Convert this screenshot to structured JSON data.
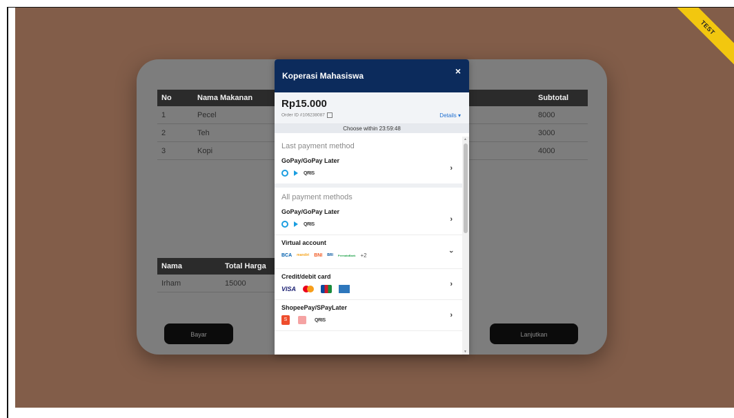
{
  "test_ribbon": "TEST",
  "background_table": {
    "headers": [
      "No",
      "Nama Makanan",
      "Subtotal"
    ],
    "rows": [
      {
        "no": "1",
        "name": "Pecel",
        "subtotal": "8000"
      },
      {
        "no": "2",
        "name": "Teh",
        "subtotal": "3000"
      },
      {
        "no": "3",
        "name": "Kopi",
        "subtotal": "4000"
      }
    ]
  },
  "summary_table": {
    "headers": [
      "Nama",
      "Total Harga"
    ],
    "row": {
      "name": "Irham",
      "total": "15000"
    }
  },
  "buttons": {
    "bayar": "Bayar",
    "lanjutkan": "Lanjutkan"
  },
  "modal": {
    "title": "Koperasi Mahasiswa",
    "close": "×",
    "amount": "Rp15.000",
    "order_id": "Order ID #106238087",
    "details": "Details ▾",
    "timer": "Choose within 23:59:48",
    "last_label": "Last payment method",
    "all_label": "All payment methods",
    "methods": {
      "last_gopay": "GoPay/GoPay Later",
      "gopay": "GoPay/GoPay Later",
      "va": "Virtual account",
      "card": "Credit/debit card",
      "shopee": "ShopeePay/SPayLater"
    },
    "va_logos": {
      "bca": "BCA",
      "mandiri": "mandiri",
      "bni": "BNI",
      "bri": "BRI",
      "permata": "PermataBank",
      "more": "+2"
    },
    "card_logos": {
      "visa": "VISA"
    },
    "qris": "QRIS",
    "shopee_logo": "S"
  },
  "colors": {
    "background": "#825d49",
    "modal_header": "#0c2b5c",
    "ribbon": "#f2c70f",
    "link": "#1f6fd0"
  }
}
